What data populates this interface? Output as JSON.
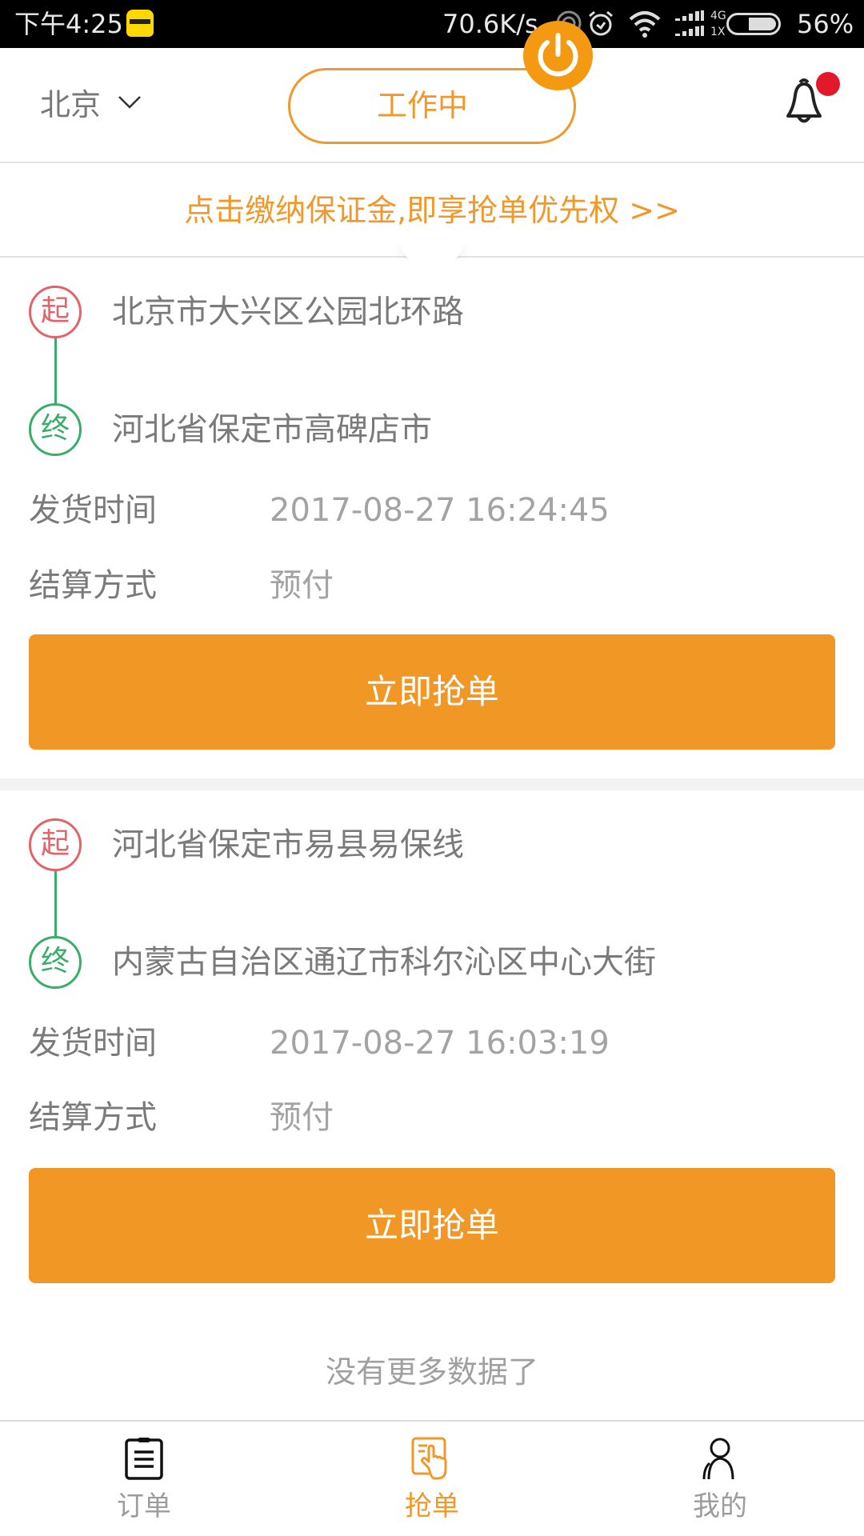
{
  "status_bar": {
    "time": "下午4:25",
    "net_speed": "70.6K/s",
    "network_top": "4G",
    "network_bottom": "1X",
    "battery_percent": "56%",
    "battery_level": 0.56,
    "icons": [
      "app-notification-icon",
      "hotspot-icon",
      "alarm-icon",
      "wifi-icon",
      "signal-icon",
      "battery-icon"
    ]
  },
  "header": {
    "city": "北京",
    "work_status_label": "工作中",
    "work_status_on": true,
    "notification_badge": true
  },
  "banner": {
    "text": "点击缴纳保证金,即享抢单优先权 >>"
  },
  "orders": [
    {
      "start_badge": "起",
      "end_badge": "终",
      "start_address": "北京市大兴区公园北环路",
      "end_address": "河北省保定市高碑店市",
      "ship_time_label": "发货时间",
      "ship_time": "2017-08-27 16:24:45",
      "payment_label": "结算方式",
      "payment": "预付",
      "grab_button": "立即抢单"
    },
    {
      "start_badge": "起",
      "end_badge": "终",
      "start_address": "河北省保定市易县易保线",
      "end_address": "内蒙古自治区通辽市科尔沁区中心大街",
      "ship_time_label": "发货时间",
      "ship_time": "2017-08-27 16:03:19",
      "payment_label": "结算方式",
      "payment": "预付",
      "grab_button": "立即抢单"
    }
  ],
  "list_footer": "没有更多数据了",
  "tab_bar": {
    "active_index": 1,
    "tabs": [
      {
        "label": "订单",
        "icon": "clipboard-icon"
      },
      {
        "label": "抢单",
        "icon": "grab-order-hand-icon"
      },
      {
        "label": "我的",
        "icon": "user-icon"
      }
    ]
  },
  "colors": {
    "accent": "#f09726",
    "start_badge": "#e2636a",
    "end_badge": "#3aad6b",
    "notification_dot": "#e3192b"
  }
}
